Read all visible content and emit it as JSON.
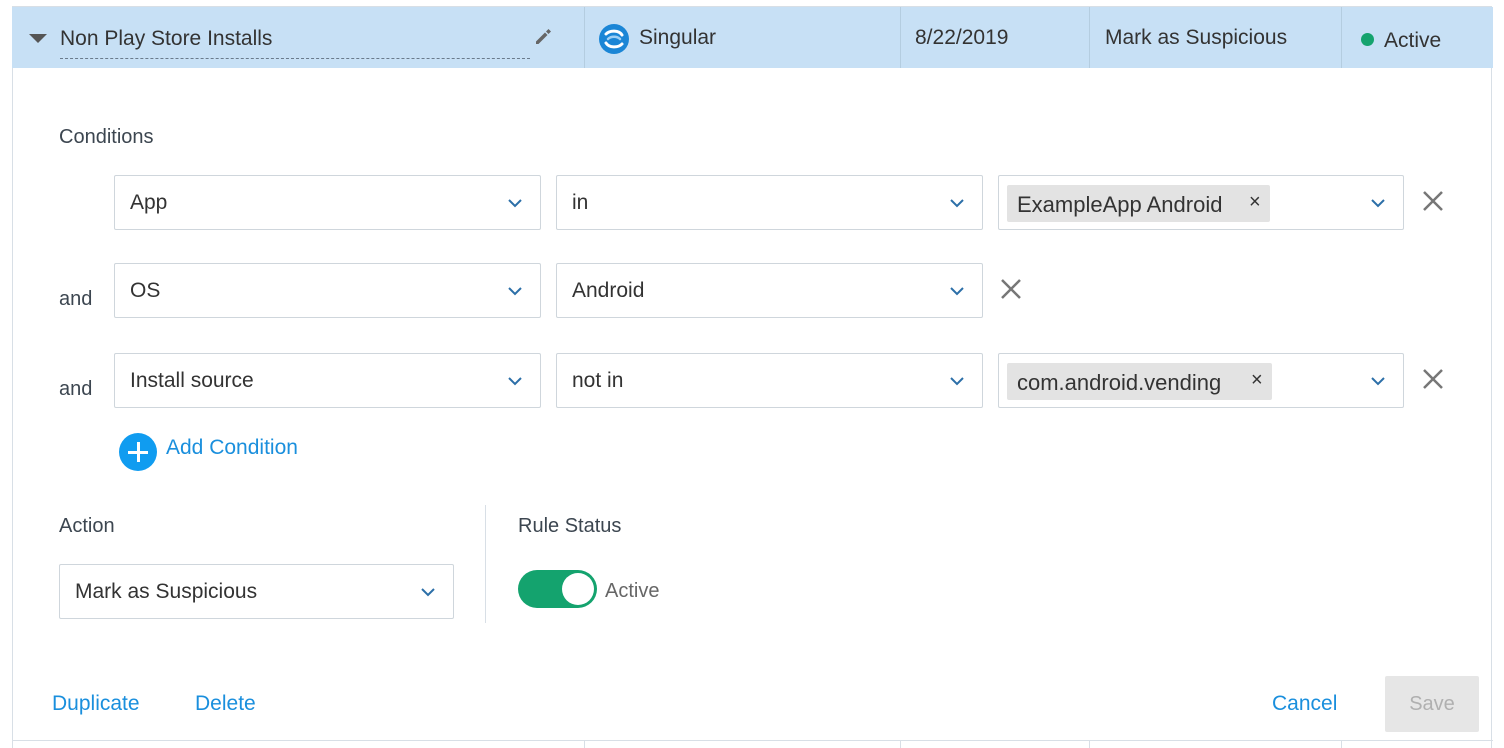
{
  "rule": {
    "name": "Non Play Store Installs",
    "source": "Singular",
    "date": "8/22/2019",
    "action": "Mark as Suspicious",
    "status": "Active",
    "status_color": "#15a36e"
  },
  "conditions": {
    "label": "Conditions",
    "connector": "and",
    "rows": [
      {
        "field": "App",
        "operator": "in",
        "values": [
          "ExampleApp Android"
        ]
      },
      {
        "field": "OS",
        "operator": "Android",
        "values": []
      },
      {
        "field": "Install source",
        "operator": "not in",
        "values": [
          "com.android.vending"
        ]
      }
    ],
    "add_label": "Add Condition"
  },
  "action_section": {
    "label": "Action",
    "selected": "Mark as Suspicious"
  },
  "status_section": {
    "label": "Rule Status",
    "toggle_label": "Active",
    "toggle_on": true
  },
  "footer": {
    "duplicate": "Duplicate",
    "delete": "Delete",
    "cancel": "Cancel",
    "save": "Save"
  },
  "colors": {
    "header_bg": "#c7e0f5",
    "link": "#1a8fdd",
    "accent_green": "#14a36e",
    "add_button": "#109cf0"
  }
}
